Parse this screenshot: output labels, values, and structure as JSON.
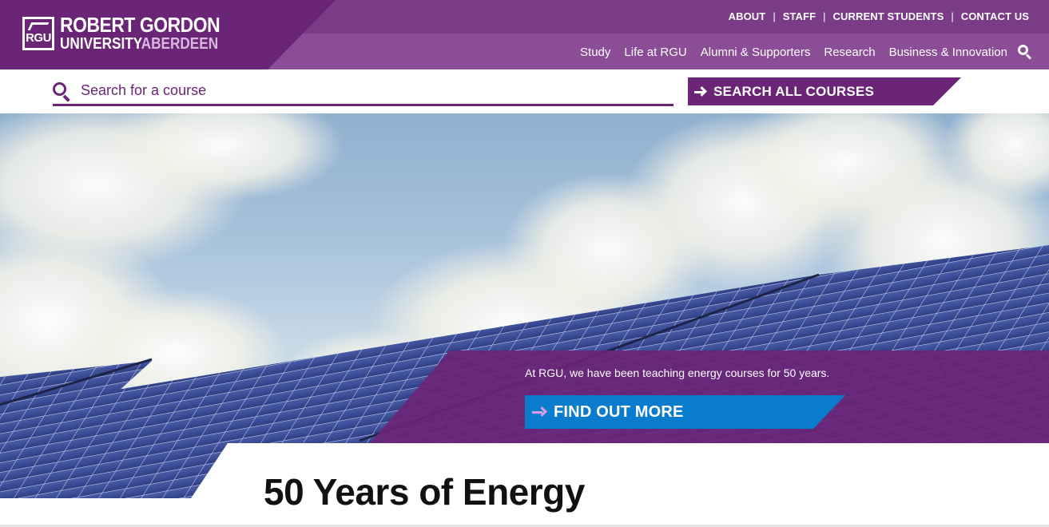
{
  "brand": {
    "logo_mark": "RGU",
    "name_line1": "ROBERT GORDON",
    "name_line2": "UNIVERSITY",
    "name_line2_accent": "ABERDEEN"
  },
  "utility_nav": [
    {
      "label": "ABOUT"
    },
    {
      "label": "STAFF"
    },
    {
      "label": "CURRENT STUDENTS"
    },
    {
      "label": "CONTACT US"
    }
  ],
  "utility_separator": "|",
  "main_nav": [
    {
      "label": "Study"
    },
    {
      "label": "Life at RGU"
    },
    {
      "label": "Alumni & Supporters"
    },
    {
      "label": "Research"
    },
    {
      "label": "Business & Innovation"
    }
  ],
  "course_search": {
    "placeholder": "Search for a course",
    "value": "",
    "button_label": "SEARCH ALL COURSES"
  },
  "hero": {
    "text": "At RGU, we have been teaching energy courses for 50 years.",
    "cta_label": "FIND OUT MORE"
  },
  "page": {
    "title": "50 Years of Energy"
  },
  "colors": {
    "brand_purple": "#6b2577",
    "nav_purple": "#8a4d96",
    "cta_blue": "#0a7ccd"
  }
}
